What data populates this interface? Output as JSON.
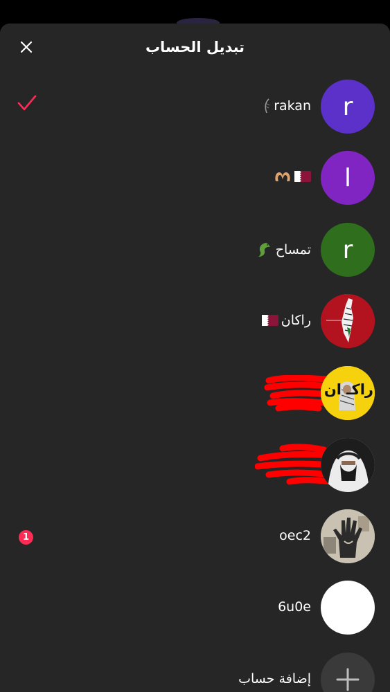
{
  "header": {
    "title": "تبديل الحساب"
  },
  "accounts": [
    {
      "name": "rakan",
      "avatar_letter": "r",
      "avatar_color": "#5b31c9",
      "selected": true
    },
    {
      "name": "",
      "avatar_letter": "l",
      "avatar_color": "#8125c2"
    },
    {
      "name": "تمساح",
      "avatar_letter": "r",
      "avatar_color": "#2e6e1c"
    },
    {
      "name": "راكان",
      "avatar_color": "#b3131f"
    },
    {
      "name": "",
      "avatar_text": "راكـ ان",
      "avatar_color": "#f6d10e"
    },
    {
      "name": "",
      "avatar_color": "#cfcfcf"
    },
    {
      "name": "oec2",
      "avatar_color": "#c9c2b2",
      "notification_count": "1"
    },
    {
      "name": "6u0e",
      "avatar_color": "#ffffff"
    }
  ],
  "add_account": {
    "label": "إضافة حساب",
    "icon": "plus-icon"
  },
  "colors": {
    "accent": "#fe2c55",
    "sheet_bg": "#262626",
    "redaction": "#ff0000"
  }
}
